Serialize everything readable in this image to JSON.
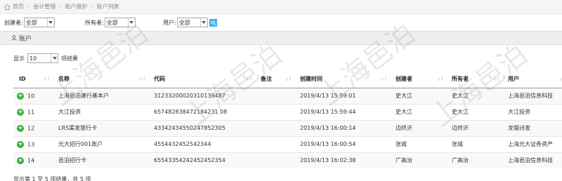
{
  "breadcrumb": [
    "首页",
    "会计管理",
    "账户维护",
    "账户列表"
  ],
  "filters": {
    "creator_label": "创建者:",
    "creator_value": "全部",
    "owner_label": "所有者:",
    "owner_value": "全部",
    "user_label": "用户:",
    "user_value": "全部"
  },
  "panel": {
    "title": "账户"
  },
  "page_length": {
    "prefix": "显示",
    "value": "10",
    "suffix": "项结果"
  },
  "table": {
    "columns": [
      "ID",
      "名称",
      "代码",
      "备注",
      "创建时间",
      "创建者",
      "所有者",
      "用户"
    ],
    "rows": [
      [
        "10",
        "上海邑泊建行基本户",
        "31233200020310139487",
        "",
        "2019/4/13 15:59:01",
        "史大江",
        "史大江",
        "上海邑泊信息科技"
      ],
      [
        "11",
        "大江投资",
        "657482838472184231 08",
        "",
        "2019/4/13 15:59:44",
        "史大江",
        "史大江",
        "大江投资"
      ],
      [
        "12",
        "LRS渠发银行卡",
        "43342434550247852305",
        "",
        "2019/4/13 16:00:14",
        "边终沂",
        "边终沂",
        "龙猫诗发"
      ],
      [
        "13",
        "光大招行001账户",
        "4554432452542344",
        "",
        "2019/4/13 16:00:54",
        "张城",
        "张城",
        "上海光大证券资产"
      ],
      [
        "14",
        "邑泊招行卡",
        "65543354242452452354",
        "",
        "2019/4/13 16:02:38",
        "广高治",
        "广高治",
        "上海邑泊信息科技"
      ]
    ]
  },
  "info_text": "显示第 1 至 5 项结果，共 5 项",
  "watermark": "上海邑泊"
}
